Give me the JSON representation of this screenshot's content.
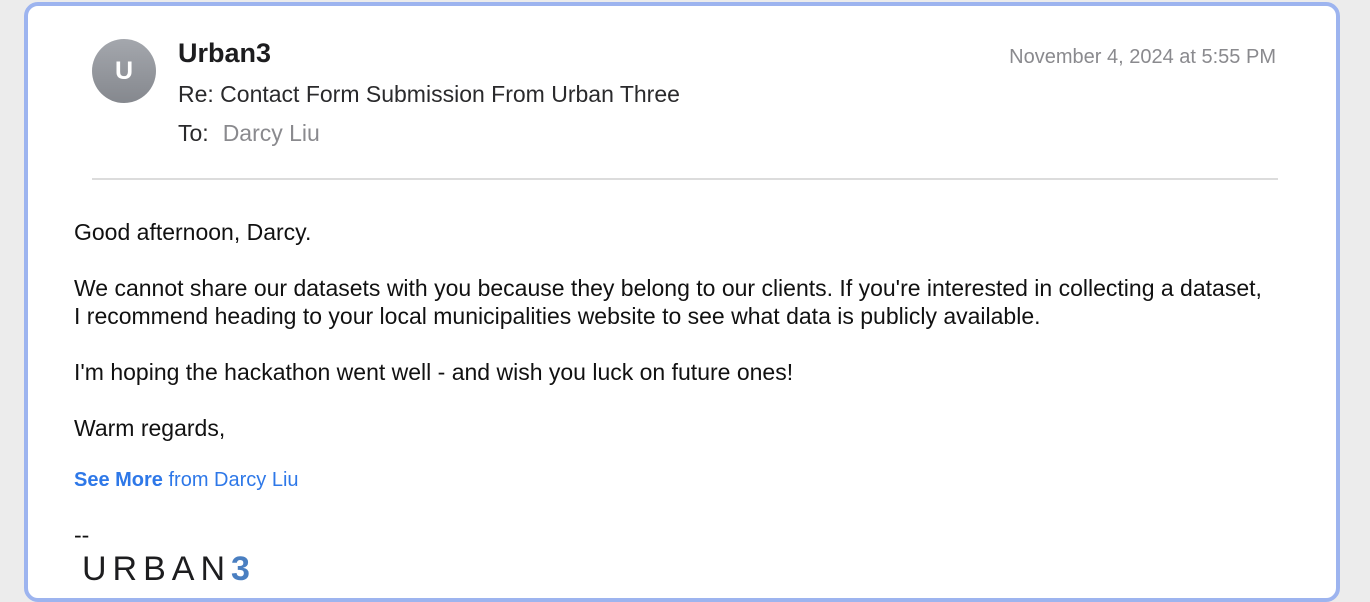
{
  "message": {
    "avatar_initial": "U",
    "sender": "Urban3",
    "timestamp": "November 4, 2024 at 5:55 PM",
    "subject": "Re: Contact Form Submission From Urban Three",
    "to_label": "To:",
    "to_value": "Darcy Liu"
  },
  "body": {
    "greeting": "Good afternoon, Darcy.",
    "paragraph1": "We cannot share our datasets with you because they belong to our clients. If you're interested in collecting a dataset, I recommend heading to your local municipalities website to see what data is publicly available.",
    "paragraph2": "I'm hoping the hackathon went well - and wish you luck on future ones!",
    "closing": "Warm regards,"
  },
  "see_more": {
    "strong": "See More",
    "rest": "from Darcy Liu"
  },
  "signature": {
    "dash": "--",
    "logo_text": "URBAN",
    "logo_accent": "3"
  },
  "colors": {
    "link": "#2e78e8",
    "window_border": "#9db4ef",
    "logo_accent": "#4a7fc1"
  }
}
